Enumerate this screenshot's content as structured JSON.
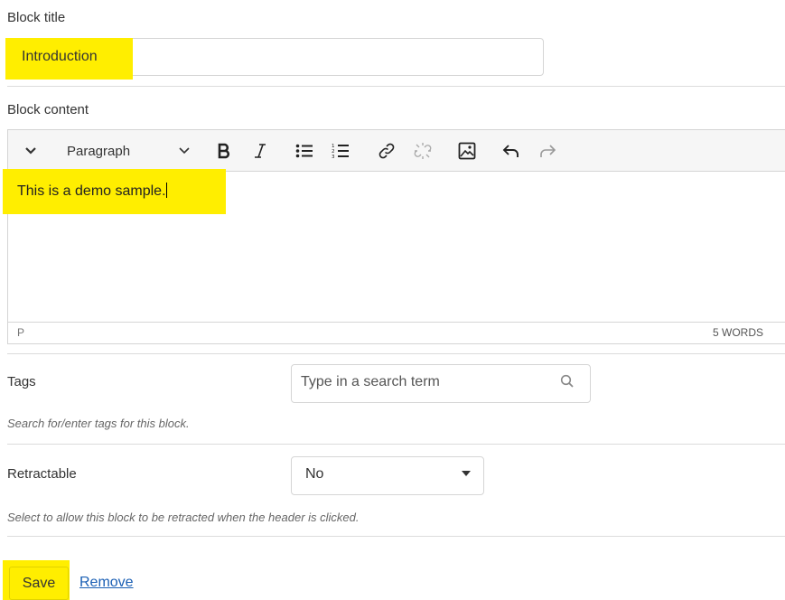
{
  "form": {
    "block_title": {
      "label": "Block title",
      "value": "Introduction"
    },
    "block_content": {
      "label": "Block content",
      "format": "Paragraph",
      "text": "This is a demo sample.",
      "path": "P",
      "word_count": "5 WORDS"
    },
    "tags": {
      "label": "Tags",
      "placeholder": "Type in a search term",
      "help": "Search for/enter tags for this block."
    },
    "retractable": {
      "label": "Retractable",
      "selected": "No",
      "help": "Select to allow this block to be retracted when the header is clicked."
    },
    "actions": {
      "save": "Save",
      "remove": "Remove"
    }
  },
  "icons": {
    "collapse": "chevron-down-icon",
    "format_dropdown": "chevron-down-icon",
    "bold": "bold-icon",
    "italic": "italic-icon",
    "bullet_list": "bullet-list-icon",
    "numbered_list": "numbered-list-icon",
    "link": "link-icon",
    "unlink": "unlink-icon",
    "image": "image-icon",
    "undo": "undo-icon",
    "redo": "redo-icon",
    "search": "search-icon",
    "select_caret": "caret-down-icon"
  },
  "colors": {
    "highlight": "#ffee00",
    "link": "#1a5fb4",
    "border": "#d5d5d5"
  }
}
